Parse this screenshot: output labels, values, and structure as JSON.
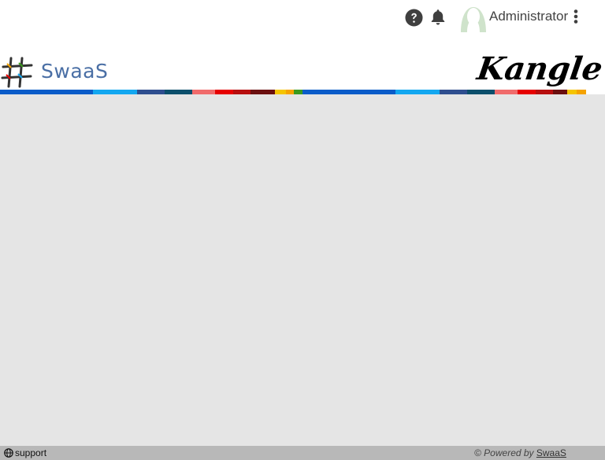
{
  "header": {
    "help_icon": "question-circle-icon",
    "notifications_icon": "bell-icon",
    "avatar_icon": "user-avatar-icon",
    "username": "Administrator",
    "menu_icon": "kebab-menu-icon"
  },
  "branding": {
    "left_logo_text": "SwaaS",
    "right_logo_text": "Kangle"
  },
  "footer": {
    "support_label": "support",
    "powered_prefix": "© Powered by",
    "powered_link": "SwaaS"
  },
  "colors": {
    "content_bg": "#e5e5e5",
    "footer_bg": "#b8b8b8",
    "stripe": [
      "#0a5cc9",
      "#13a7f0",
      "#2e4e8f",
      "#0b4f6c",
      "#f06b6b",
      "#e60000",
      "#b70e0e",
      "#6b0f0f",
      "#f5c400",
      "#f5a300",
      "#3a9a1d"
    ]
  }
}
